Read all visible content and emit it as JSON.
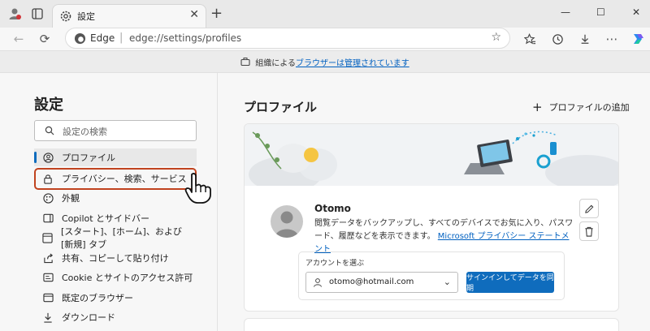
{
  "tab": {
    "title": "設定",
    "close": "✕"
  },
  "toolbar": {
    "new_tab": "+"
  },
  "window": {
    "minimize": "—",
    "maximize": "☐",
    "close": "✕"
  },
  "address": {
    "brand": "Edge",
    "separator": "|",
    "url": "edge://settings/profiles"
  },
  "banner": {
    "prefix": "組織による",
    "link": "ブラウザーは管理されています"
  },
  "sidebar": {
    "title": "設定",
    "search_placeholder": "設定の検索",
    "items": [
      {
        "label": "プロファイル",
        "icon": "profile-icon"
      },
      {
        "label": "プライバシー、検索、サービス",
        "icon": "lock-icon"
      },
      {
        "label": "外観",
        "icon": "appearance-icon"
      },
      {
        "label": "Copilot とサイドバー",
        "icon": "sidebar-icon"
      },
      {
        "label": "[スタート]、[ホーム]、および [新規] タブ",
        "icon": "home-tabs-icon"
      },
      {
        "label": "共有、コピーして貼り付け",
        "icon": "share-icon"
      },
      {
        "label": "Cookie とサイトのアクセス許可",
        "icon": "cookie-icon"
      },
      {
        "label": "既定のブラウザー",
        "icon": "browser-icon"
      },
      {
        "label": "ダウンロード",
        "icon": "download-icon"
      }
    ]
  },
  "main": {
    "title": "プロファイル",
    "add_profile": "プロファイルの追加",
    "profile": {
      "name": "Otomo",
      "desc": "閲覧データをバックアップし、すべてのデバイスでお気に入り、パスワード、履歴などを表示できます。",
      "link": "Microsoft プライバシー ステートメント"
    },
    "account": {
      "label": "アカウントを選ぶ",
      "selected": "otomo@hotmail.com",
      "sync_button": "サインインしてデータを同期"
    }
  },
  "colors": {
    "accent": "#0f6cbd",
    "highlight": "#c0431f"
  }
}
